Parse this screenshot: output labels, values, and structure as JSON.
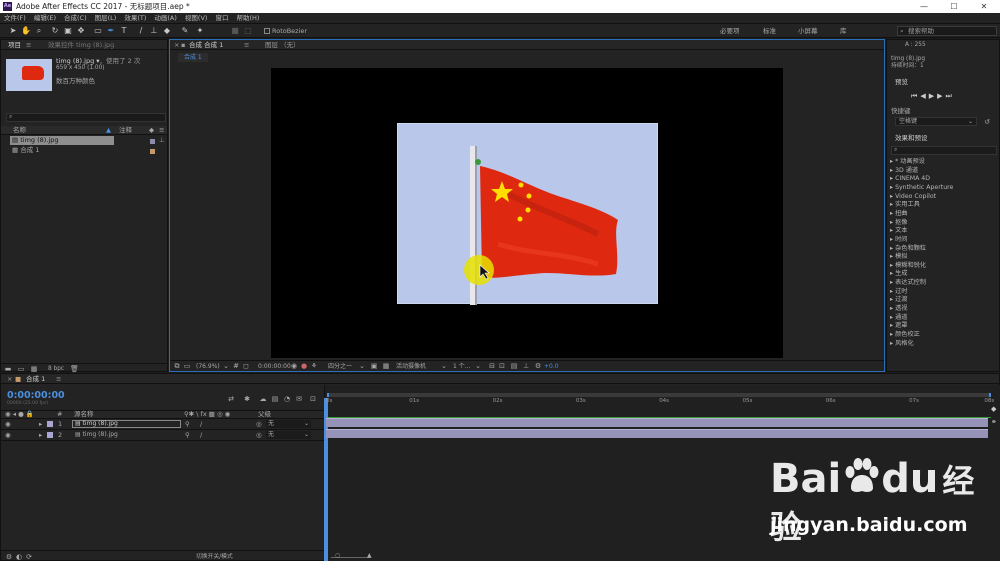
{
  "window": {
    "title": "Adobe After Effects CC 2017 - 无标题项目.aep *",
    "app_icon": "Ae",
    "min": "—",
    "max": "☐",
    "close": "✕"
  },
  "menu": [
    "文件(F)",
    "编辑(E)",
    "合成(C)",
    "图层(L)",
    "效果(T)",
    "动画(A)",
    "视图(V)",
    "窗口",
    "帮助(H)"
  ],
  "toolbar": {
    "roto_label": "RotoBezier",
    "workspaces": [
      "必要项",
      "标准",
      "小屏幕",
      "库"
    ],
    "search_placeholder": "搜索帮助"
  },
  "project": {
    "tab_project": "项目",
    "tab_effect_controls": "效果控件 timg (8).jpg",
    "file_name": "timg (8).jpg ▾",
    "used": "，使用了 2 次",
    "dims": "659 x 450 (1.00)",
    "color": "数百万种颜色",
    "col_name": "名称",
    "col_comment": "注释",
    "items": [
      {
        "name": "timg (8).jpg",
        "type": "image"
      },
      {
        "name": "合成 1",
        "type": "comp"
      }
    ],
    "bpc": "8 bpc"
  },
  "composition": {
    "tab": "合成 合成 1",
    "layer_tab": "图层 （无）",
    "breadcrumb": "合成 1",
    "zoom": "(76.9%)",
    "timecode": "0:00:00:00",
    "resolution": "四分之一",
    "camera": "活动摄像机",
    "views": "1 个...",
    "exposure": "+0.0"
  },
  "right": {
    "info_a": "A : 255",
    "info_file": "timg (8).jpg",
    "info_duration": "持续时间：1",
    "preview_title": "预览",
    "shortcut_label": "快捷键",
    "shortcut_value": "空格键",
    "effects_title": "效果和预设",
    "effects": [
      "* 动画预设",
      "3D 通道",
      "CINEMA 4D",
      "Synthetic Aperture",
      "Video Copilot",
      "实用工具",
      "扭曲",
      "抠像",
      "文本",
      "时间",
      "杂色和颗粒",
      "模拟",
      "模糊和锐化",
      "生成",
      "表达式控制",
      "过时",
      "过渡",
      "透视",
      "通道",
      "遮罩",
      "颜色校正",
      "风格化"
    ]
  },
  "timeline": {
    "tab": "合成 1",
    "timecode": "0:00:00:00",
    "fps": "00000 (25.00 fps)",
    "col_num": "#",
    "col_source": "源名称",
    "col_parent": "父级",
    "ruler": [
      "0s",
      "01s",
      "02s",
      "03s",
      "04s",
      "05s",
      "06s",
      "07s",
      "08s"
    ],
    "layers": [
      {
        "num": "1",
        "name": "timg (8).jpg",
        "parent": "无"
      },
      {
        "num": "2",
        "name": "timg (8).jpg",
        "parent": "无"
      }
    ],
    "switch_label": "切换开关/模式"
  },
  "watermark": {
    "brand": "Bai",
    "brand2": "du",
    "brand_cn": "经验",
    "url": "jingyan.baidu.com"
  },
  "colors": {
    "accent": "#4a8fe0",
    "track": "#9593b8",
    "flag": "#de2910",
    "star": "#ffde00",
    "sky": "#b9c7ea"
  }
}
